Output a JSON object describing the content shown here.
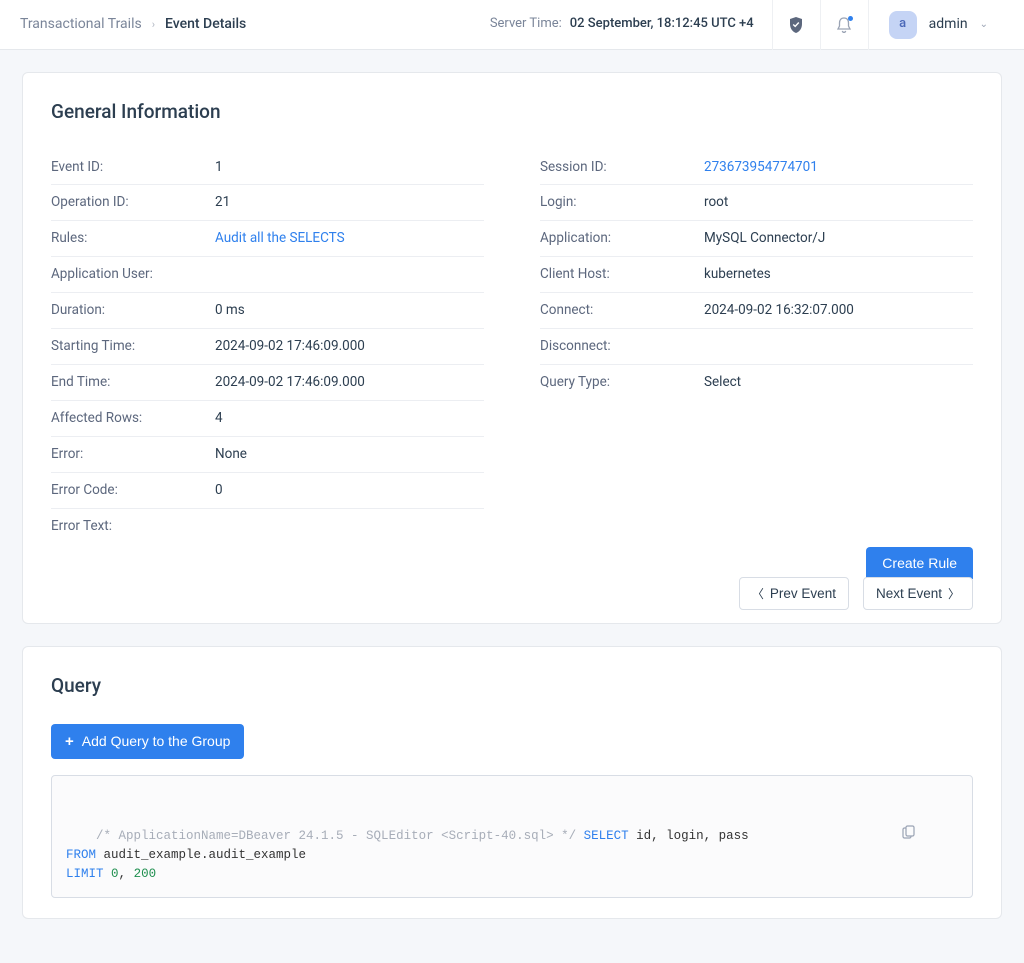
{
  "breadcrumb": {
    "root": "Transactional Trails",
    "current": "Event Details"
  },
  "server_time": {
    "label": "Server Time:",
    "value": "02 September, 18:12:45  UTC +4"
  },
  "user": {
    "initial": "a",
    "name": "admin"
  },
  "general": {
    "title": "General Information",
    "left": [
      {
        "label": "Event ID:",
        "value": "1"
      },
      {
        "label": "Operation ID:",
        "value": "21"
      },
      {
        "label": "Rules:",
        "value": "Audit all the SELECTS",
        "link": true
      },
      {
        "label": "Application User:",
        "value": ""
      },
      {
        "label": "Duration:",
        "value": "0 ms"
      },
      {
        "label": "Starting Time:",
        "value": "2024-09-02 17:46:09.000"
      },
      {
        "label": "End Time:",
        "value": "2024-09-02 17:46:09.000"
      },
      {
        "label": "Affected Rows:",
        "value": "4"
      },
      {
        "label": "Error:",
        "value": "None"
      },
      {
        "label": "Error Code:",
        "value": "0"
      },
      {
        "label": "Error Text:",
        "value": ""
      }
    ],
    "right": [
      {
        "label": "Session ID:",
        "value": "273673954774701",
        "link": true
      },
      {
        "label": "Login:",
        "value": "root"
      },
      {
        "label": "Application:",
        "value": "MySQL Connector/J"
      },
      {
        "label": "Client Host:",
        "value": "kubernetes"
      },
      {
        "label": "Connect:",
        "value": "2024-09-02 16:32:07.000"
      },
      {
        "label": "Disconnect:",
        "value": ""
      },
      {
        "label": "Query Type:",
        "value": "Select"
      }
    ]
  },
  "buttons": {
    "create_rule": "Create Rule",
    "prev_event": "Prev Event",
    "next_event": "Next Event",
    "add_query": "Add Query to the Group"
  },
  "query": {
    "title": "Query",
    "tokens": [
      {
        "t": "/* ApplicationName=DBeaver 24.1.5 - SQLEditor <Script-40.sql> */ ",
        "c": "comment"
      },
      {
        "t": "SELECT",
        "c": "keyword"
      },
      {
        "t": " id, login, pass\n",
        "c": "plain"
      },
      {
        "t": "FROM",
        "c": "keyword"
      },
      {
        "t": " audit_example.audit_example\n",
        "c": "plain"
      },
      {
        "t": "LIMIT",
        "c": "keyword"
      },
      {
        "t": " ",
        "c": "plain"
      },
      {
        "t": "0",
        "c": "number"
      },
      {
        "t": ", ",
        "c": "plain"
      },
      {
        "t": "200",
        "c": "number"
      }
    ]
  }
}
